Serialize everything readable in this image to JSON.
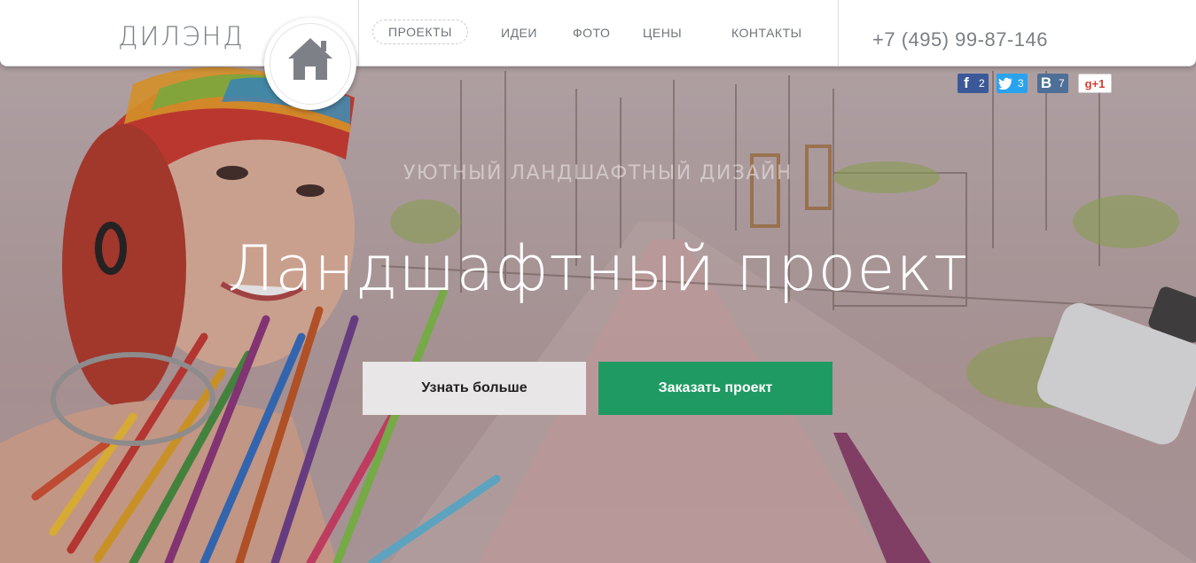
{
  "header": {
    "logo": "ДИЛЭНД",
    "nav": [
      {
        "label": "ПРОЕКТЫ"
      },
      {
        "label": "ИДЕИ"
      },
      {
        "label": "ФОТО"
      },
      {
        "label": "ЦЕНЫ"
      },
      {
        "label": "КОНТАКТЫ"
      }
    ],
    "phone": "+7 (495) 99-87-146"
  },
  "social": {
    "facebook": {
      "icon": "facebook-icon",
      "count": "2"
    },
    "twitter": {
      "icon": "twitter-icon",
      "count": "3"
    },
    "vk": {
      "icon": "vk-icon",
      "count": "7"
    },
    "gplus": {
      "label": "g+1"
    }
  },
  "hero": {
    "subtitle": "УЮТНЫЙ ЛАНДШАФТНЫЙ ДИЗАЙН",
    "title": "Ландшафтный проект",
    "btn_more": "Узнать больше",
    "btn_order": "Заказать проект"
  },
  "colors": {
    "accent_green": "#1f9a63",
    "header_bg": "#ffffff",
    "nav_text": "#6f747a"
  }
}
